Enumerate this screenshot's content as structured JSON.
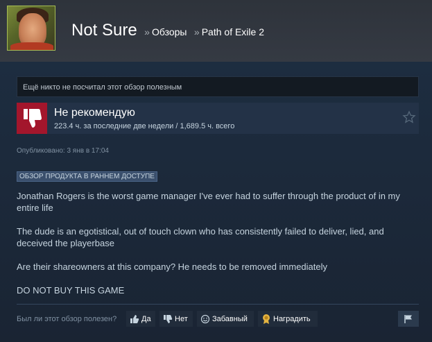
{
  "header": {
    "username": "Not Sure",
    "breadcrumb_sep": "»",
    "section": "Обзоры",
    "game": "Path of Exile 2"
  },
  "review": {
    "helpful_count_text": "Ещё никто не посчитал этот обзор полезным",
    "verdict": "Не рекомендую",
    "hours": "223.4 ч. за последние две недели / 1,689.5 ч. всего",
    "posted": "Опубликовано: 3 янв в 17:04",
    "early_access_tag": "ОБЗОР ПРОДУКТА В РАННЕМ ДОСТУПЕ",
    "paragraphs": [
      "Jonathan Rogers is the worst game manager I've ever had to suffer through the product of in my entire life",
      "The dude is an egotistical, out of touch clown who has consistently failed to deliver, lied, and deceived the playerbase",
      "Are their shareowners at this company? He needs to be removed immediately",
      "DO NOT BUY THIS GAME"
    ]
  },
  "controls": {
    "question": "Был ли этот обзор полезен?",
    "yes": "Да",
    "no": "Нет",
    "funny": "Забавный",
    "award": "Наградить"
  },
  "colors": {
    "background": "#1b2838",
    "thumb_down": "#a3162c",
    "award": "#e3b341"
  },
  "icons": [
    "thumbs-down-icon",
    "star-icon",
    "thumbs-up-icon",
    "smiley-icon",
    "award-icon",
    "flag-icon"
  ]
}
